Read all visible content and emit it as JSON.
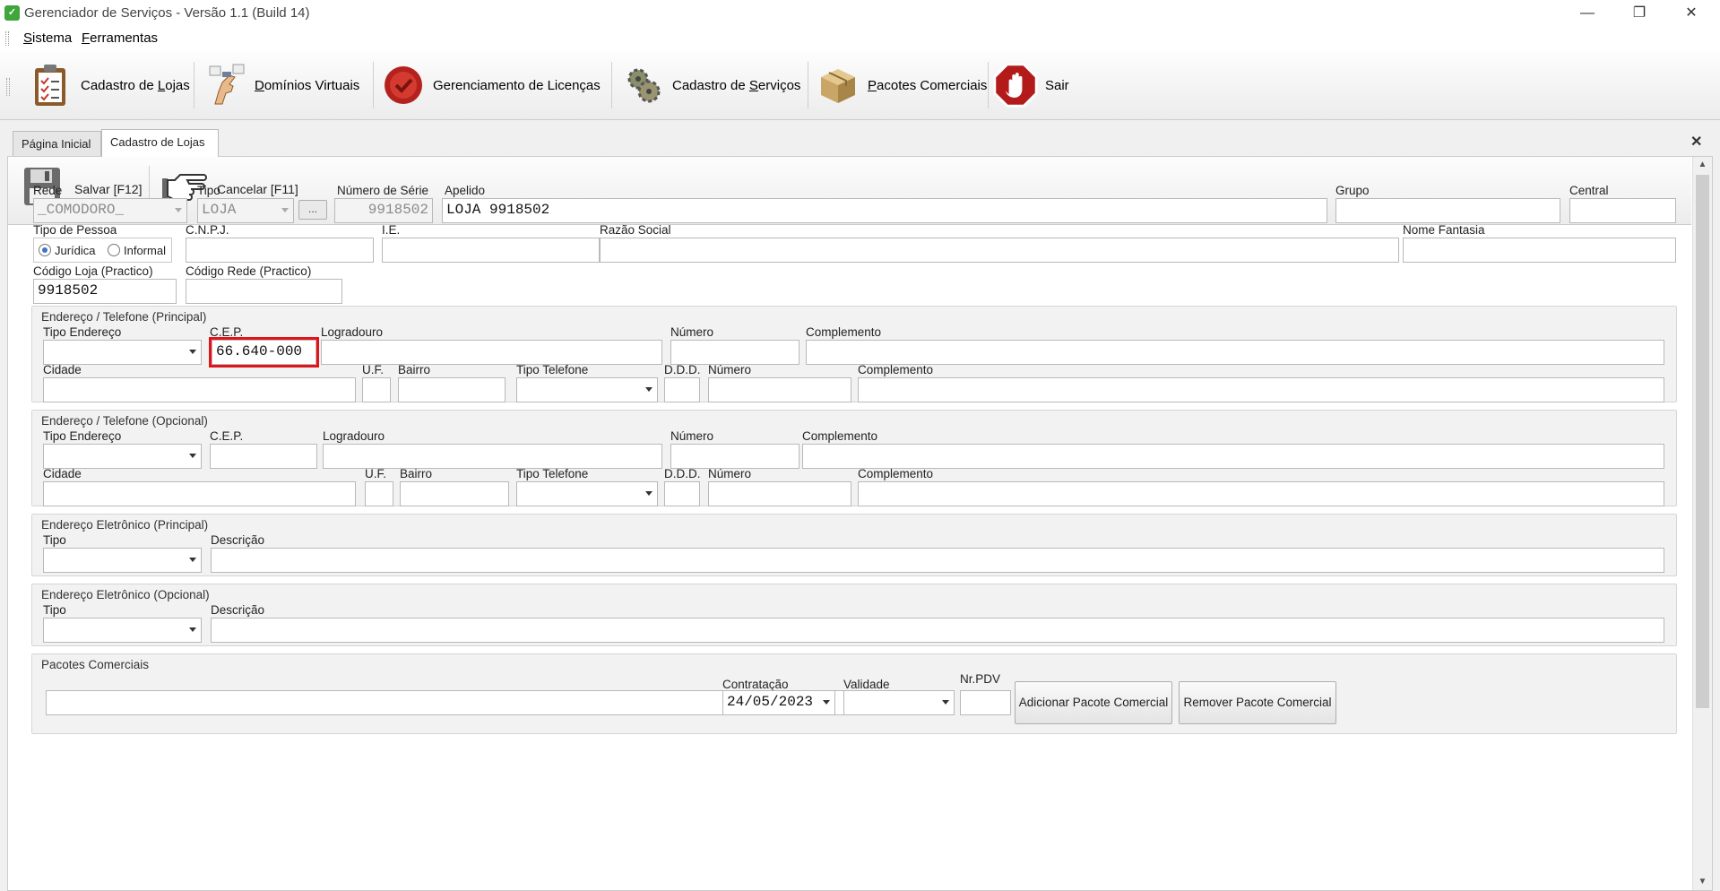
{
  "window": {
    "title": "Gerenciador de Serviços - Versão 1.1 (Build 14)",
    "minimize": "—",
    "restore": "❐",
    "close": "✕"
  },
  "menu": {
    "items": [
      {
        "label": "Sistema"
      },
      {
        "label": "Ferramentas"
      }
    ]
  },
  "toolbar": {
    "buttons": [
      {
        "label": "Cadastro de Lojas",
        "icon": "clipboard-icon"
      },
      {
        "label": "Domínios Virtuais",
        "icon": "pointing-hand-icon"
      },
      {
        "label": "Gerenciamento de Licenças",
        "icon": "wax-seal-icon"
      },
      {
        "label": "Cadastro de Serviços",
        "icon": "gears-icon"
      },
      {
        "label": "Pacotes Comerciais",
        "icon": "box-icon"
      },
      {
        "label": "Sair",
        "icon": "stop-hand-icon"
      }
    ]
  },
  "tabs": [
    {
      "label": "Página Inicial",
      "active": false
    },
    {
      "label": "Cadastro de Lojas",
      "active": true
    }
  ],
  "tab_close": "✕",
  "actions": {
    "save": "Salvar [F12]",
    "cancel": "Cancelar [F11]"
  },
  "form": {
    "rede": {
      "label": "Rede",
      "value": "_COMODORO_"
    },
    "tipo": {
      "label": "Tipo",
      "value": "LOJA"
    },
    "browse": "...",
    "numero_serie": {
      "label": "Número de Série",
      "value": "9918502"
    },
    "apelido": {
      "label": "Apelido",
      "value": "LOJA 9918502"
    },
    "grupo": {
      "label": "Grupo",
      "value": ""
    },
    "central": {
      "label": "Central",
      "value": ""
    },
    "tipo_pessoa": {
      "label": "Tipo de Pessoa",
      "options": [
        "Jurídica",
        "Informal"
      ],
      "selected": "Jurídica"
    },
    "cnpj": {
      "label": "C.N.P.J.",
      "value": ""
    },
    "ie": {
      "label": "I.E.",
      "value": ""
    },
    "razao_social": {
      "label": "Razão Social",
      "value": ""
    },
    "nome_fantasia": {
      "label": "Nome Fantasia",
      "value": ""
    },
    "codigo_loja": {
      "label": "Código Loja (Practico)",
      "value": "9918502"
    },
    "codigo_rede": {
      "label": "Código Rede (Practico)",
      "value": ""
    }
  },
  "endereco_principal": {
    "title": "Endereço / Telefone (Principal)",
    "tipo_endereco": "Tipo Endereço",
    "cep": "C.E.P.",
    "cep_value": "66.640-000",
    "logradouro": "Logradouro",
    "numero": "Número",
    "complemento": "Complemento",
    "cidade": "Cidade",
    "uf": "U.F.",
    "bairro": "Bairro",
    "tipo_telefone": "Tipo Telefone",
    "ddd": "D.D.D.",
    "numero_tel": "Número",
    "complemento_tel": "Complemento"
  },
  "endereco_opcional": {
    "title": "Endereço / Telefone (Opcional)",
    "tipo_endereco": "Tipo Endereço",
    "cep": "C.E.P.",
    "logradouro": "Logradouro",
    "numero": "Número",
    "complemento": "Complemento",
    "cidade": "Cidade",
    "uf": "U.F.",
    "bairro": "Bairro",
    "tipo_telefone": "Tipo Telefone",
    "ddd": "D.D.D.",
    "numero_tel": "Número",
    "complemento_tel": "Complemento"
  },
  "eletronico_principal": {
    "title": "Endereço Eletrônico (Principal)",
    "tipo": "Tipo",
    "descricao": "Descrição"
  },
  "eletronico_opcional": {
    "title": "Endereço Eletrônico (Opcional)",
    "tipo": "Tipo",
    "descricao": "Descrição"
  },
  "pacotes": {
    "title": "Pacotes Comerciais",
    "contratacao": "Contratação",
    "contratacao_value": "24/05/2023",
    "validade": "Validade",
    "nr_pdv": "Nr.PDV",
    "add": "Adicionar Pacote Comercial",
    "remove": "Remover Pacote Comercial"
  },
  "colors": {
    "highlight": "#e0151b",
    "radio_selected": "#3b76c7",
    "app_icon": "#3fa63a"
  }
}
